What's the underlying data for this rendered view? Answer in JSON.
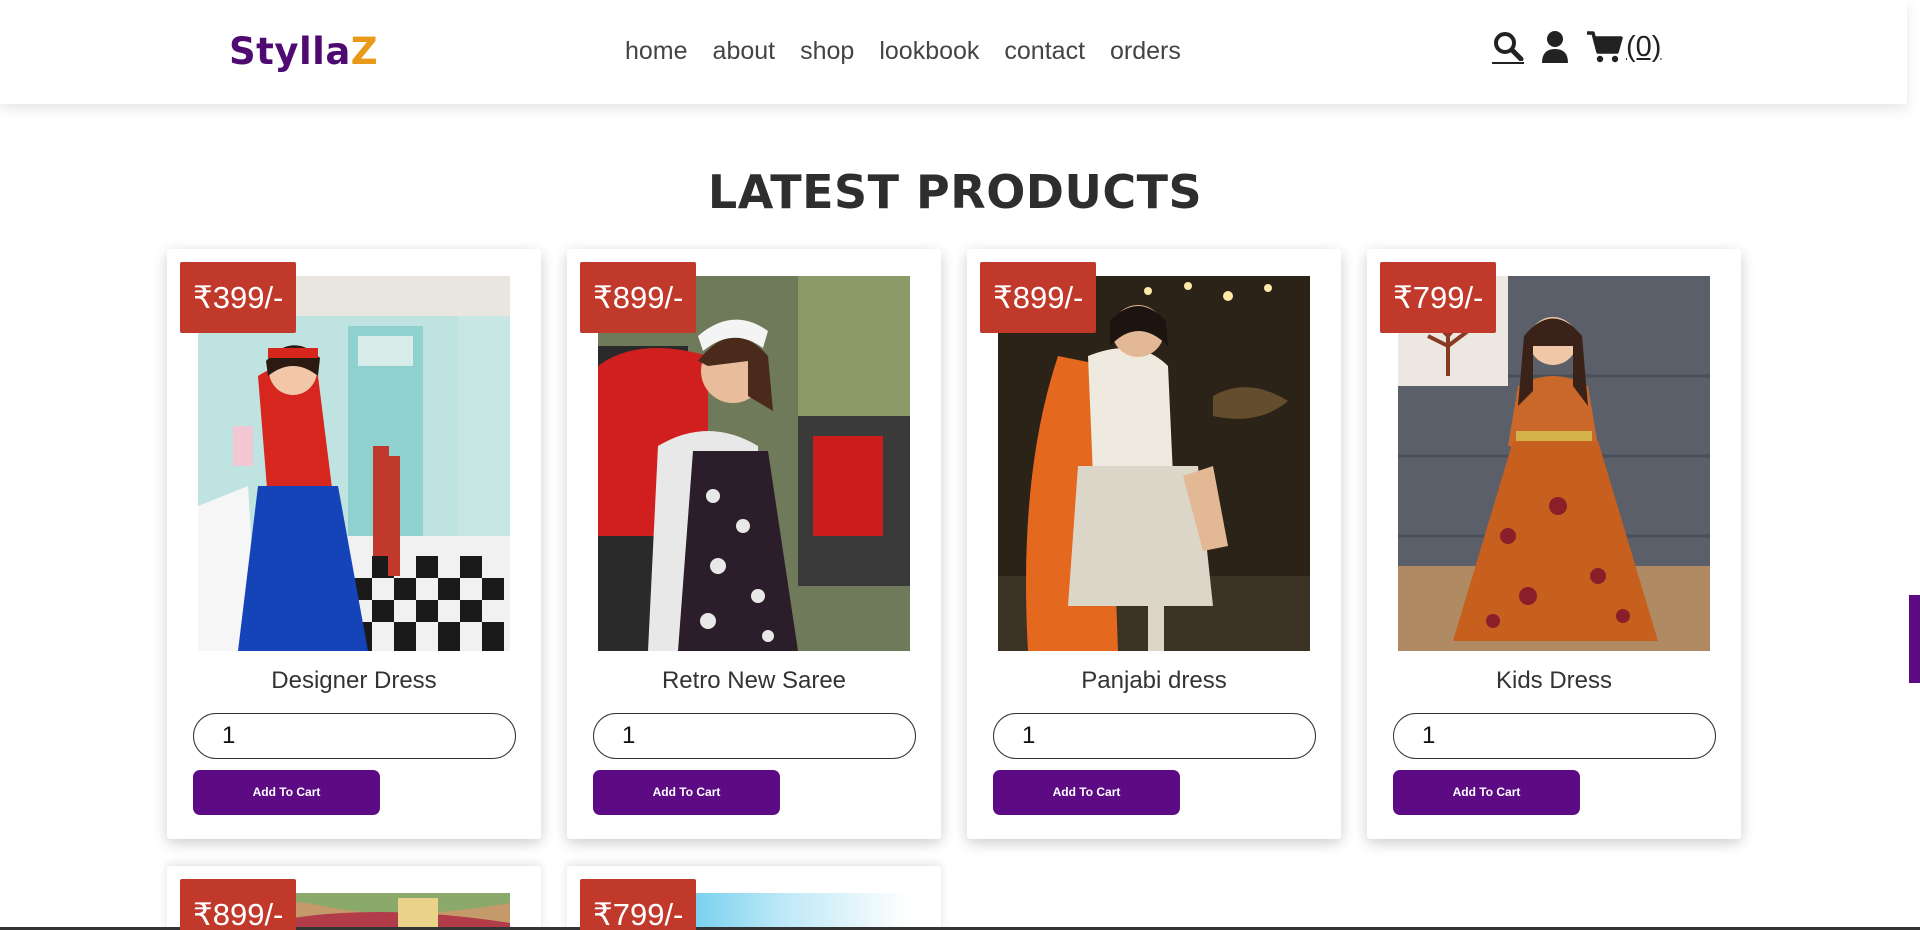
{
  "header": {
    "logo_part1": "Stylla",
    "logo_part2": "Z",
    "nav": [
      "home",
      "about",
      "shop",
      "lookbook",
      "contact",
      "orders"
    ],
    "icons": [
      "search-icon",
      "user-icon",
      "cart-icon"
    ],
    "cart_count": "(0)"
  },
  "section_title": "LATEST PRODUCTS",
  "products": [
    {
      "price": "₹399/-",
      "name": "Designer Dress",
      "qty": "1",
      "button": "Add To Cart"
    },
    {
      "price": "₹899/-",
      "name": "Retro New Saree",
      "qty": "1",
      "button": "Add To Cart"
    },
    {
      "price": "₹899/-",
      "name": "Panjabi dress",
      "qty": "1",
      "button": "Add To Cart"
    },
    {
      "price": "₹799/-",
      "name": "Kids Dress",
      "qty": "1",
      "button": "Add To Cart"
    },
    {
      "price": "₹899/-"
    },
    {
      "price": "₹799/-"
    }
  ],
  "colors": {
    "brand_purple": "#5c0b85",
    "logo_accent": "#e89a18",
    "price_tag": "#c0392b"
  }
}
